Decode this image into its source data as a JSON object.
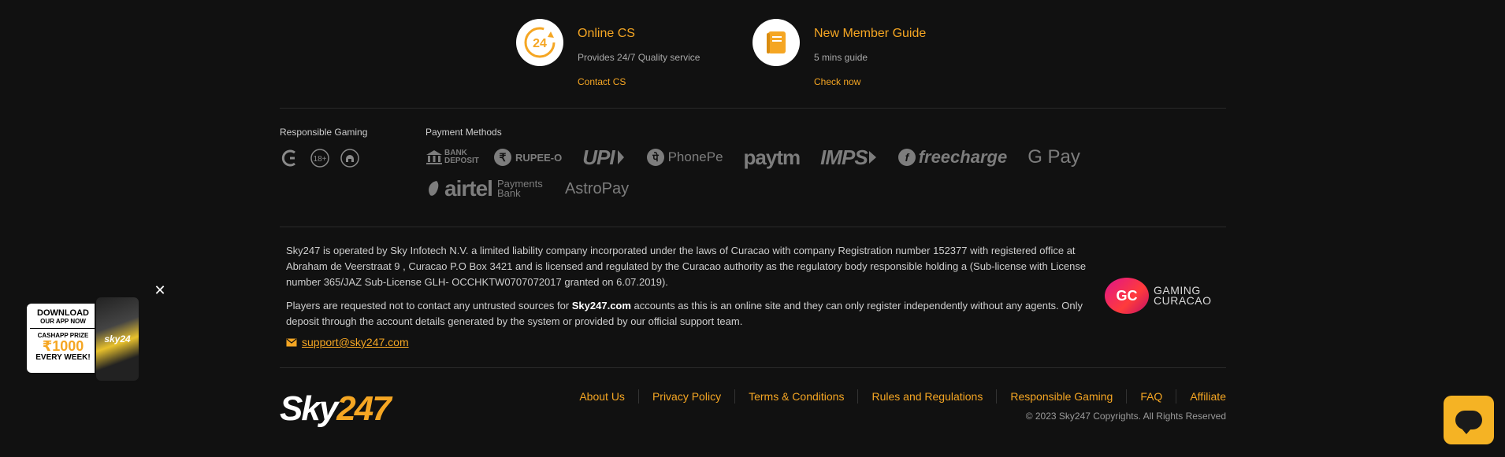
{
  "support": {
    "online_cs": {
      "icon": "24-hours-icon",
      "badge": "24",
      "title": "Online CS",
      "description": "Provides 24/7 Quality service",
      "link": "Contact CS"
    },
    "member_guide": {
      "icon": "book-icon",
      "title": "New Member Guide",
      "description": "5 mins guide",
      "link": "Check now"
    }
  },
  "responsible_gaming": {
    "label": "Responsible Gaming",
    "icons": [
      "gamcare-icon",
      "age-18-plus-icon",
      "gambling-therapy-icon"
    ],
    "age_text": "18+"
  },
  "payment_methods": {
    "label": "Payment Methods",
    "row1": [
      {
        "icon": "bank-deposit-icon",
        "name": "BANK DEPOSIT"
      },
      {
        "icon": "rupee-o-icon",
        "name": "RUPEE-O"
      },
      {
        "icon": "upi-icon",
        "name": "UPI"
      },
      {
        "icon": "phonepe-icon",
        "name": "PhonePe"
      },
      {
        "icon": "paytm-icon",
        "name": "paytm"
      },
      {
        "icon": "imps-icon",
        "name": "IMPS"
      },
      {
        "icon": "freecharge-icon",
        "name": "freecharge"
      },
      {
        "icon": "gpay-icon",
        "name": "G Pay"
      }
    ],
    "row2": [
      {
        "icon": "airtel-icon",
        "name": "airtel",
        "sub": "Payments Bank"
      },
      {
        "icon": "astropay-icon",
        "name": "AstroPay"
      }
    ]
  },
  "legal": {
    "p1": "Sky247 is operated by Sky Infotech N.V. a limited liability company incorporated under the laws of Curacao with company Registration number 152377 with registered office at Abraham de Veerstraat 9 , Curacao P.O Box 3421 and is licensed and regulated by the Curacao authority as the regulatory body responsible holding a (Sub-license with License number 365/JAZ Sub-License GLH- OCCHKTW0707072017 granted on 6.07.2019).",
    "p2_before": "Players are requested not to contact any untrusted sources for ",
    "p2_bold": "Sky247.com",
    "p2_after": " accounts as this is an online site and they can only register independently without any agents. Only deposit through the account details generated by the system or provided by our official support team.",
    "email": "support@sky247.com"
  },
  "gaming_curacao": {
    "mark": "GC",
    "line1": "GAMING",
    "line2": "CURACAO"
  },
  "brand": {
    "sky": "Sky",
    "num": "247"
  },
  "footer_nav": [
    "About Us",
    "Privacy Policy",
    "Terms & Conditions",
    "Rules and Regulations",
    "Responsible Gaming",
    "FAQ",
    "Affiliate"
  ],
  "copyright": "© 2023 Sky247 Copyrights. All Rights Reserved",
  "promo": {
    "line1": "DOWNLOAD",
    "line2": "OUR APP NOW",
    "line3": "CASHAPP PRIZE",
    "line4": "₹1000",
    "line5": "EVERY WEEK!",
    "phone_brand": "sky24",
    "close": "✕"
  },
  "colors": {
    "accent": "#f5a623",
    "background": "#111111"
  }
}
